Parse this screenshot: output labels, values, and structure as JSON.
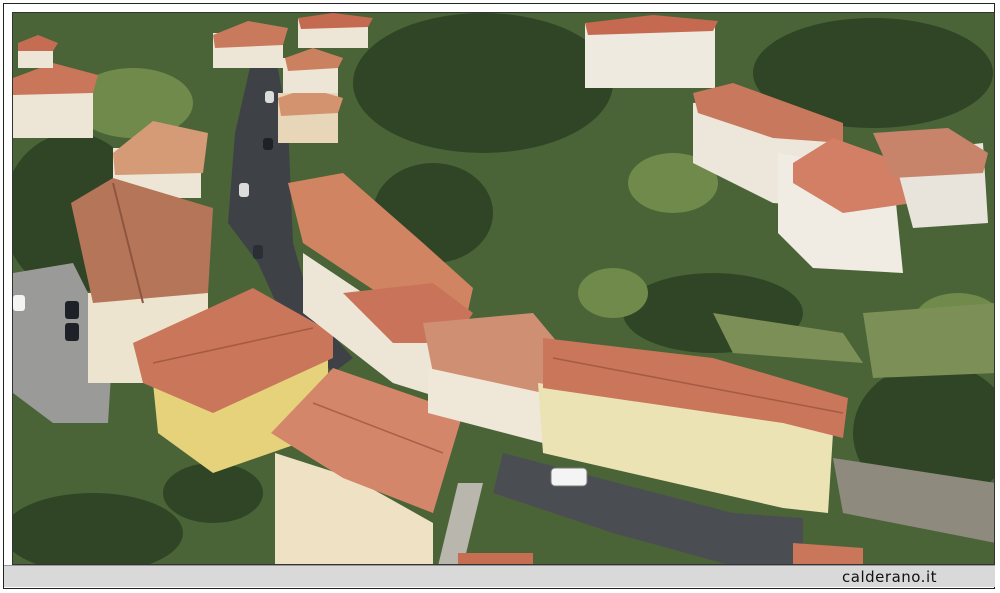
{
  "photo": {
    "subject": "aerial-village-view",
    "colors": {
      "vegetation": "#3f5a2e",
      "roof_terracotta": "#c9765a",
      "wall_yellow": "#e6d27a",
      "wall_cream": "#efe7d2",
      "road_asphalt": "#3e4247"
    }
  },
  "caption": {
    "watermark": "calderano.it"
  }
}
